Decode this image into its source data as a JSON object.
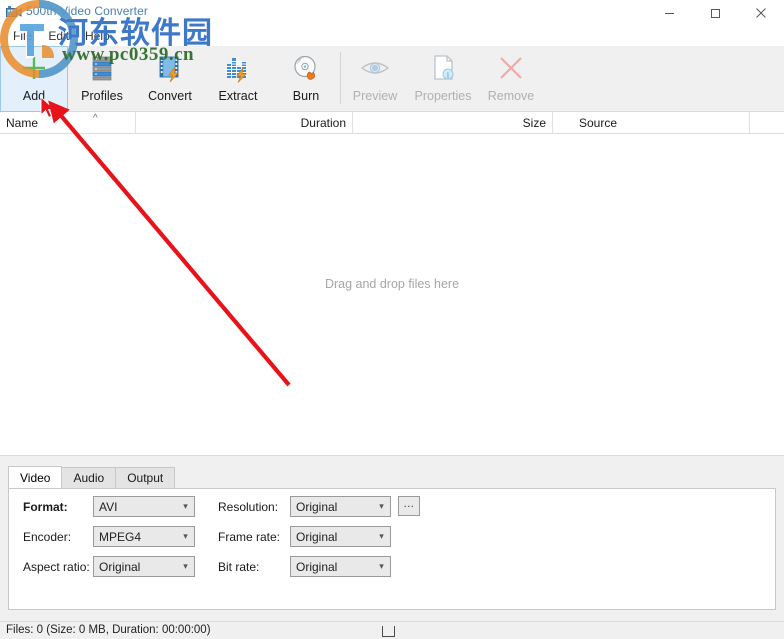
{
  "window": {
    "title": "500th Video Converter",
    "app_icon": "video-camera-icon",
    "controls": {
      "minimize": "minimize-icon",
      "maximize": "maximize-icon",
      "close": "close-icon"
    }
  },
  "menubar": {
    "items": [
      {
        "label": "File"
      },
      {
        "label": "Edit"
      },
      {
        "label": "Help"
      }
    ]
  },
  "toolbar": {
    "buttons": [
      {
        "label": "Add",
        "icon": "plus-icon",
        "state": "selected"
      },
      {
        "label": "Profiles",
        "icon": "server-stack-icon",
        "state": "enabled"
      },
      {
        "label": "Convert",
        "icon": "film-lightning-icon",
        "state": "enabled"
      },
      {
        "label": "Extract",
        "icon": "equalizer-lightning-icon",
        "state": "enabled"
      },
      {
        "label": "Burn",
        "icon": "disc-flame-icon",
        "state": "enabled"
      },
      {
        "label": "Preview",
        "icon": "eye-icon",
        "state": "disabled"
      },
      {
        "label": "Properties",
        "icon": "document-info-icon",
        "state": "disabled"
      },
      {
        "label": "Remove",
        "icon": "x-cross-icon",
        "state": "disabled"
      }
    ]
  },
  "filelist": {
    "columns": [
      {
        "label": "Name",
        "align": "left"
      },
      {
        "label": "Duration",
        "align": "right"
      },
      {
        "label": "Size",
        "align": "right"
      },
      {
        "label": "Source",
        "align": "left"
      }
    ],
    "sort_indicator": "^",
    "empty_message": "Drag and drop files here",
    "rows": []
  },
  "settings_panel": {
    "tabs": [
      {
        "label": "Video",
        "active": true
      },
      {
        "label": "Audio",
        "active": false
      },
      {
        "label": "Output",
        "active": false
      }
    ],
    "fields": {
      "format_label": "Format:",
      "format_value": "AVI",
      "encoder_label": "Encoder:",
      "encoder_value": "MPEG4",
      "aspect_label": "Aspect ratio:",
      "aspect_value": "Original",
      "resolution_label": "Resolution:",
      "resolution_value": "Original",
      "framerate_label": "Frame rate:",
      "framerate_value": "Original",
      "bitrate_label": "Bit rate:",
      "bitrate_value": "Original",
      "browse_label": "..."
    }
  },
  "statusbar": {
    "text": "Files: 0 (Size: 0 MB, Duration: 00:00:00)"
  },
  "watermark": {
    "chinese_text": "河东软件园",
    "url_text": "www.pc0359.cn"
  },
  "colors": {
    "accent_blue": "#3a7ebf",
    "toolbar_bg": "#f0f0f0",
    "selected_bg": "#e3f0fb",
    "selected_border": "#9cc8ea",
    "annotation_red": "#e8121a",
    "watermark_blue": "#2f6fc4",
    "watermark_green": "#2b6b2b",
    "title_text": "#4a7fb5"
  }
}
